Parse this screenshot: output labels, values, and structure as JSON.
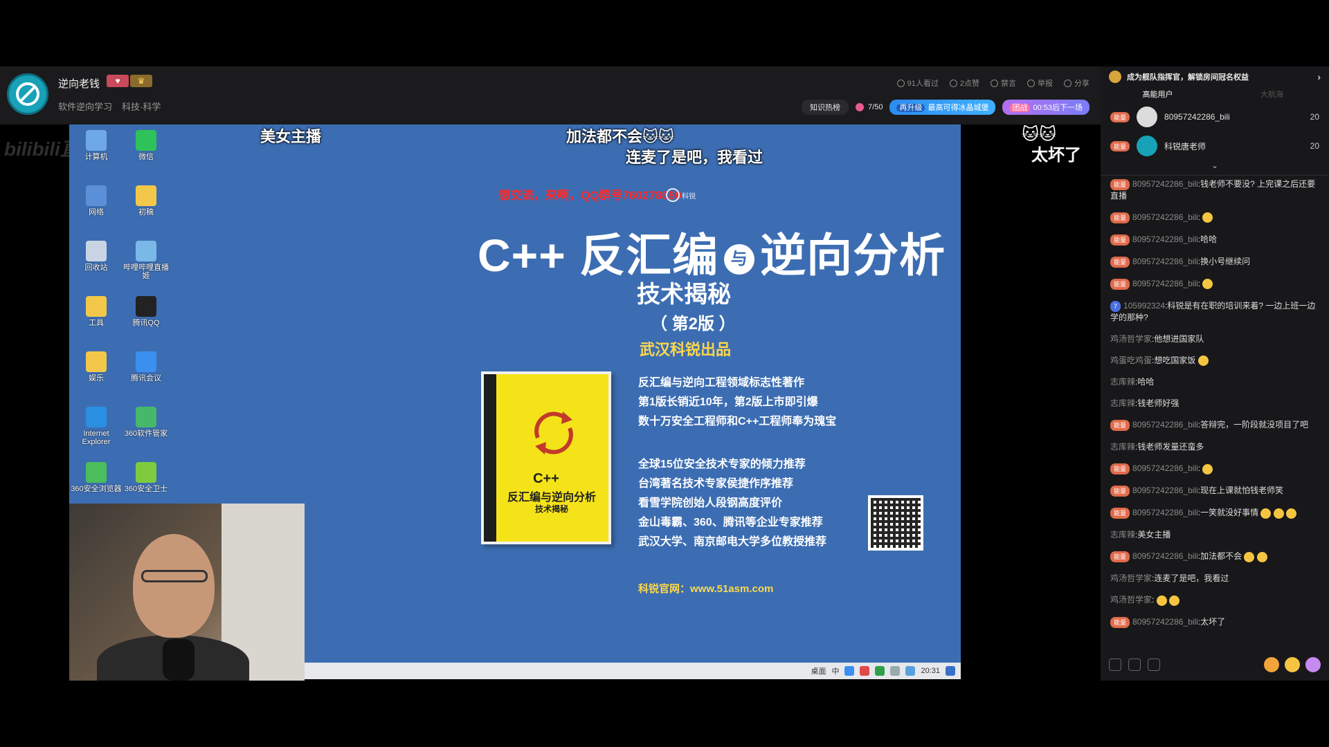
{
  "streamer": {
    "name": "逆向老钱",
    "tags": [
      "软件逆向学习",
      "科技·科学"
    ]
  },
  "header_stats": {
    "viewers": "91人看过",
    "likes": "2点赞",
    "mute": "禁言",
    "report": "举报",
    "share": "分享"
  },
  "header_row2": {
    "knowledge": "知识热榜",
    "rank": "7/50",
    "promo_tag": "再升级",
    "promo": "最高可得冰晶城堡",
    "timer_tag": "团战",
    "timer": "00:53后下一场"
  },
  "video": {
    "watermark": "bilibili直播",
    "danmaku": [
      "美女主播",
      "加法都不会🐱🐱",
      "连麦了是吧，我看过",
      "🐱🐱",
      "太坏了"
    ],
    "desktop_icons": [
      {
        "label": "计算机",
        "icon": "computer-icon",
        "color": "#6fa8e8"
      },
      {
        "label": "微信",
        "icon": "wechat-icon",
        "color": "#2fc25b"
      },
      {
        "label": "网络",
        "icon": "network-icon",
        "color": "#5b8fd8"
      },
      {
        "label": "初稿",
        "icon": "folder-icon",
        "color": "#f3c84a"
      },
      {
        "label": "回收站",
        "icon": "recycle-bin-icon",
        "color": "#c8d4e4"
      },
      {
        "label": "哔哩哔哩直播姬",
        "icon": "bilibili-icon",
        "color": "#7ab8e8"
      },
      {
        "label": "工具",
        "icon": "folder-icon",
        "color": "#f3c84a"
      },
      {
        "label": "腾讯QQ",
        "icon": "qq-icon",
        "color": "#222"
      },
      {
        "label": "娱乐",
        "icon": "folder-icon",
        "color": "#f3c84a"
      },
      {
        "label": "腾讯会议",
        "icon": "tencent-meeting-icon",
        "color": "#3a8ff0"
      },
      {
        "label": "Internet Explorer",
        "icon": "ie-icon",
        "color": "#2a8fe0"
      },
      {
        "label": "360软件管家",
        "icon": "360-manager-icon",
        "color": "#45b86a"
      },
      {
        "label": "360安全浏览器",
        "icon": "360-browser-icon",
        "color": "#4bbd5a"
      },
      {
        "label": "360安全卫士",
        "icon": "360-guard-icon",
        "color": "#7ecb3e"
      }
    ],
    "slide": {
      "qq_text": "想交流，来啊，QQ群号760278880",
      "logo": "科锐",
      "title_left": "C++ 反汇编",
      "title_yu": "与",
      "title_right": "逆向分析",
      "subtitle": "技术揭秘",
      "edition": "（ 第2版 ）",
      "publisher": "武汉科锐出品",
      "book": {
        "t1": "C++",
        "t2": "反汇编与逆向分析",
        "t3": "技术揭秘"
      },
      "bullets_a": [
        "反汇编与逆向工程领域标志性著作",
        "第1版长销近10年，第2版上市即引爆",
        "数十万安全工程师和C++工程师奉为瑰宝"
      ],
      "bullets_b": [
        "全球15位安全技术专家的倾力推荐",
        "台湾著名技术专家侯捷作序推荐",
        "看雪学院创始人段钢高度评价",
        "金山毒霸、360、腾讯等企业专家推荐",
        "武汉大学、南京邮电大学多位教授推荐"
      ],
      "site": "科锐官网：www.51asm.com"
    },
    "taskbar": {
      "left_text": "桌面",
      "ime": "中",
      "time": "20:31"
    }
  },
  "panel": {
    "fleet": "成为舰队指挥官，解锁房间冠名权益",
    "tabs": [
      "高能用户",
      "大航海"
    ],
    "top_users": [
      {
        "name": "80957242286_bili",
        "score": "20",
        "color": "#dcdcdc"
      },
      {
        "name": "科锐唐老师",
        "score": "20",
        "color": "#17a2b8"
      }
    ],
    "badge": "能量",
    "chat": [
      {
        "lvl": "能量",
        "name": "80957242286_bili",
        "text": ":钱老师不要没? 上完课之后还要直播"
      },
      {
        "lvl": "能量",
        "name": "80957242286_bili",
        "text": ":",
        "emoji": 1
      },
      {
        "lvl": "能量",
        "name": "80957242286_bili",
        "text": ":哈哈"
      },
      {
        "lvl": "能量",
        "name": "80957242286_bili",
        "text": ":换小号继续问"
      },
      {
        "lvl": "能量",
        "name": "80957242286_bili",
        "text": ":",
        "emoji": 1
      },
      {
        "lvl": "7",
        "name": "105992324",
        "text": ":科锐是有在职的培训来着? 一边上班一边学的那种?",
        "blue": true
      },
      {
        "lvl": "",
        "name": "鸡汤哲学家",
        "text": ":他想进国家队"
      },
      {
        "lvl": "",
        "name": "鸡蛋吃鸡蛋",
        "text": ":想吃国家饭",
        "emoji": 1
      },
      {
        "lvl": "",
        "name": "志库辣",
        "text": ":哈哈"
      },
      {
        "lvl": "",
        "name": "志库辣",
        "text": ":钱老师好强"
      },
      {
        "lvl": "能量",
        "name": "80957242286_bili",
        "text": ":答辩完，一阶段就没项目了吧"
      },
      {
        "lvl": "",
        "name": "志库辣",
        "text": ":钱老师发量还蛮多"
      },
      {
        "lvl": "能量",
        "name": "80957242286_bili",
        "text": ":",
        "emoji": 1
      },
      {
        "lvl": "能量",
        "name": "80957242286_bili",
        "text": ":现在上课就怕钱老师笑"
      },
      {
        "lvl": "能量",
        "name": "80957242286_bili",
        "text": ":一笑就没好事情",
        "emoji": 3
      },
      {
        "lvl": "",
        "name": "志库辣",
        "text": ":美女主播"
      },
      {
        "lvl": "能量",
        "name": "80957242286_bili",
        "text": ":加法都不会",
        "emoji": 2
      },
      {
        "lvl": "",
        "name": "鸡汤哲学家",
        "text": ":连麦了是吧，我看过"
      },
      {
        "lvl": "",
        "name": "鸡汤哲学家",
        "text": ":",
        "emoji": 2
      },
      {
        "lvl": "能量",
        "name": "80957242286_bili",
        "text": ":太坏了"
      }
    ]
  }
}
